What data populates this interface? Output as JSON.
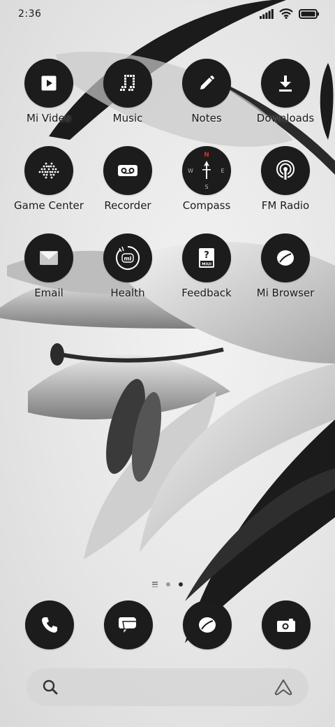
{
  "status_bar": {
    "time": "2:36",
    "icons": [
      "signal-icon",
      "wifi-icon",
      "battery-icon"
    ]
  },
  "apps": [
    {
      "label": "Mi Video",
      "icon": "play-icon"
    },
    {
      "label": "Music",
      "icon": "music-icon"
    },
    {
      "label": "Notes",
      "icon": "pencil-icon"
    },
    {
      "label": "Downloads",
      "icon": "download-icon"
    },
    {
      "label": "Game Center",
      "icon": "space-invader-icon"
    },
    {
      "label": "Recorder",
      "icon": "voicemail-icon"
    },
    {
      "label": "Compass",
      "icon": "compass-icon",
      "directions": [
        "N",
        "E",
        "S",
        "W"
      ]
    },
    {
      "label": "FM Radio",
      "icon": "radio-icon"
    },
    {
      "label": "Email",
      "icon": "envelope-icon"
    },
    {
      "label": "Health",
      "icon": "mi-health-icon",
      "badge_text": "mi"
    },
    {
      "label": "Feedback",
      "icon": "feedback-icon",
      "glyph": "?",
      "badge_text": "MIUI"
    },
    {
      "label": "Mi Browser",
      "icon": "browser-icon"
    }
  ],
  "page_indicator": {
    "pages": 2,
    "active_page": 2
  },
  "dock": [
    {
      "icon": "phone-icon"
    },
    {
      "icon": "messages-icon"
    },
    {
      "icon": "browser-icon"
    },
    {
      "icon": "camera-icon"
    }
  ],
  "search_bar": {
    "left_icon": "search-icon",
    "right_icon": "assistant-icon"
  },
  "colors": {
    "icon_background": "#1c1c1c",
    "icon_foreground": "#ffffff",
    "compass_north": "#d0312d",
    "label_text": "#1a1a1a"
  }
}
